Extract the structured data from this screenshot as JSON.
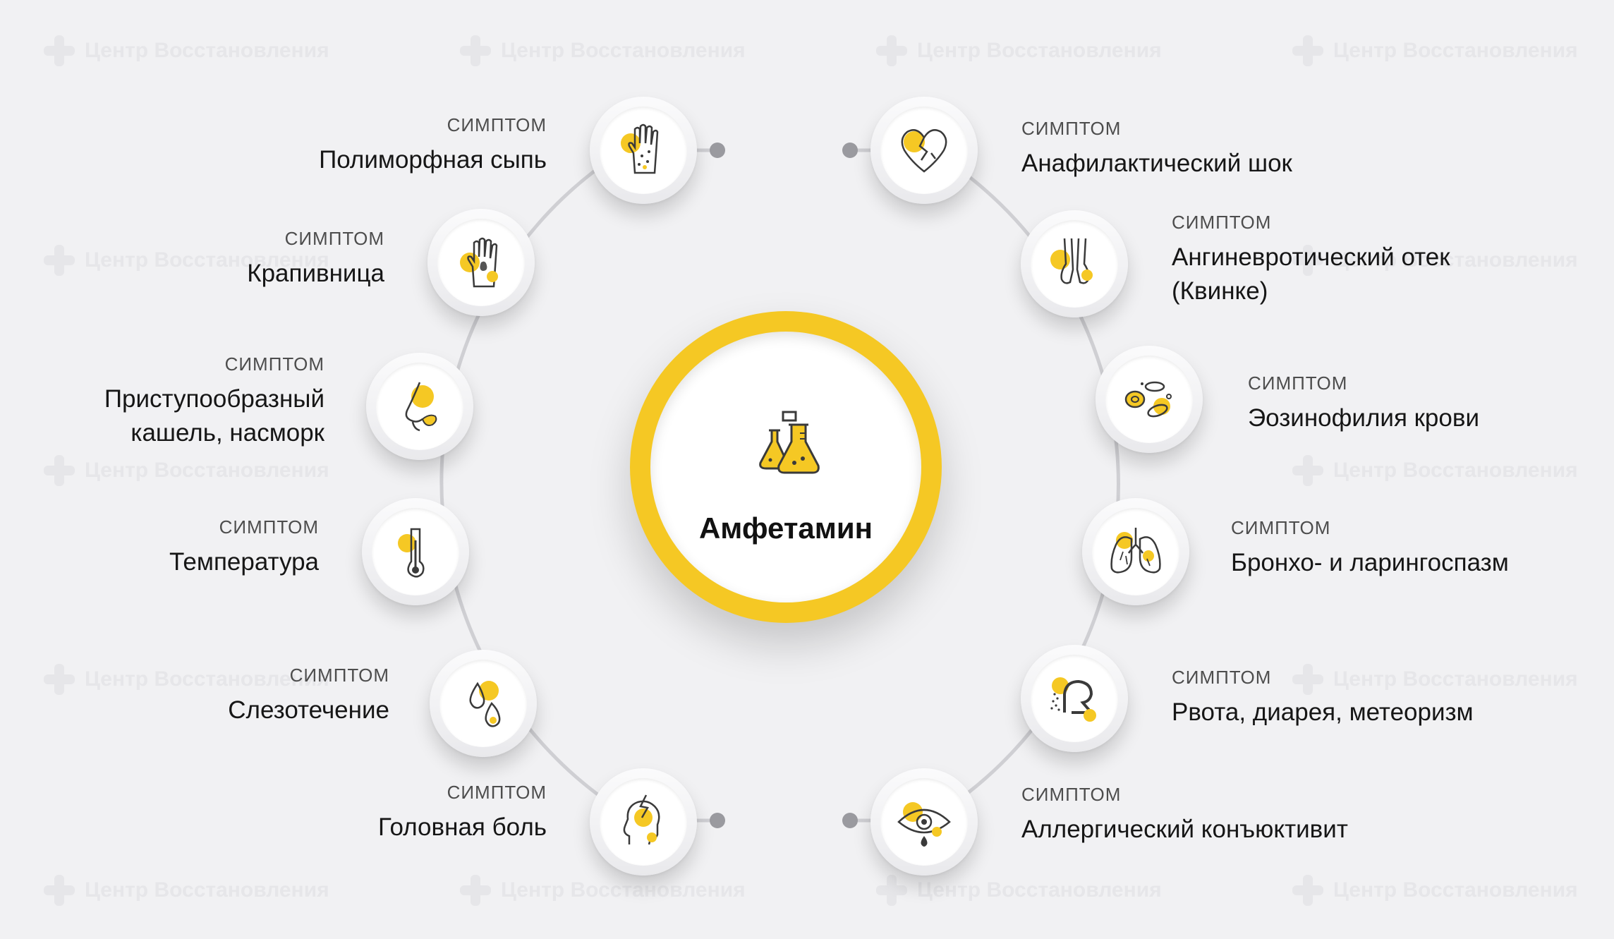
{
  "center": {
    "title": "Амфетамин",
    "icon": "lab-flasks-icon"
  },
  "symptom_kicker": "СИМПТОМ",
  "watermark": "Центр Восстановления",
  "left_items": [
    {
      "label": "Полиморфная сыпь",
      "icon": "rash-hand-icon"
    },
    {
      "label": "Крапивница",
      "icon": "hives-hand-icon"
    },
    {
      "label": "Приступообразный кашель, насморк",
      "icon": "nose-icon"
    },
    {
      "label": "Температура",
      "icon": "thermometer-icon"
    },
    {
      "label": "Слезотечение",
      "icon": "drops-icon"
    },
    {
      "label": "Головная боль",
      "icon": "headache-icon"
    }
  ],
  "right_items": [
    {
      "label": "Анафилактический шок",
      "icon": "broken-heart-icon"
    },
    {
      "label": "Ангиневротический отек (Квинке)",
      "icon": "swollen-legs-icon"
    },
    {
      "label": "Эозинофилия крови",
      "icon": "blood-cells-icon"
    },
    {
      "label": "Бронхо- и ларингоспазм",
      "icon": "lungs-icon"
    },
    {
      "label": "Рвота, диарея, метеоризм",
      "icon": "vomiting-icon"
    },
    {
      "label": "Аллергический конъюктивит",
      "icon": "crying-eye-icon"
    }
  ],
  "colors": {
    "accent": "#f5c824",
    "ring": "#c8c8cc",
    "icon_stroke": "#3a3a3a",
    "background": "#f1f1f3"
  }
}
